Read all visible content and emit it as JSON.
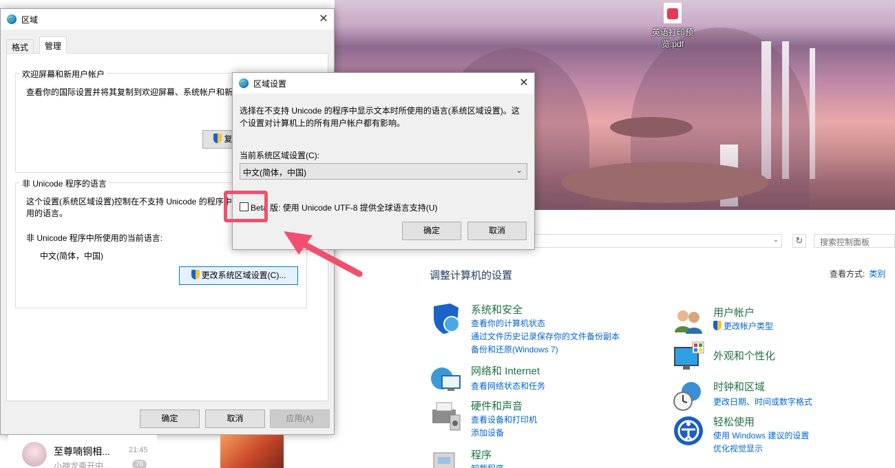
{
  "desktop": {
    "icon_label": "英语打印预览.pdf"
  },
  "control_panel": {
    "search_placeholder": "搜索控制面板",
    "title": "调整计算机的设置",
    "view_by_label": "查看方式:",
    "view_by_value": "类别",
    "categories": [
      {
        "name": "系统和安全",
        "links": [
          "查看你的计算机状态",
          "通过文件历史记录保存你的文件备份副本",
          "备份和还原(Windows 7)"
        ]
      },
      {
        "name": "网络和 Internet",
        "links": [
          "查看网络状态和任务"
        ]
      },
      {
        "name": "硬件和声音",
        "links": [
          "查看设备和打印机",
          "添加设备"
        ]
      },
      {
        "name": "程序",
        "links": [
          "卸载程序"
        ]
      },
      {
        "name": "用户帐户",
        "links": [
          "更改帐户类型"
        ]
      },
      {
        "name": "外观和个性化",
        "links": []
      },
      {
        "name": "时钟和区域",
        "links": [
          "更改日期、时间或数字格式"
        ]
      },
      {
        "name": "轻松使用",
        "links": [
          "使用 Windows 建议的设置",
          "优化视觉显示"
        ]
      }
    ]
  },
  "region_window": {
    "title": "区域",
    "tabs": [
      "格式",
      "管理"
    ],
    "welcome_group": {
      "legend": "欢迎屏幕和新用户帐户",
      "description": "查看你的国际设置并将其复制到欢迎屏幕、系统帐户和新",
      "copy_button": "复"
    },
    "non_unicode_group": {
      "legend": "非 Unicode 程序的语言",
      "description_line1": "这个设置(系统区域设置)控制在不支持 Unicode 的程序中",
      "description_line2": "用的语言。",
      "current_label": "非 Unicode 程序中所使用的当前语言:",
      "current_value": "中文(简体，中国)",
      "change_button": "更改系统区域设置(C)..."
    },
    "buttons": {
      "ok": "确定",
      "cancel": "取消",
      "apply": "应用(A)"
    }
  },
  "region_settings_dialog": {
    "title": "区域设置",
    "description_line1": "选择在不支持 Unicode 的程序中显示文本时所使用的语言(系统区域设置)。这",
    "description_line2": "个设置对计算机上的所有用户帐户都有影响。",
    "current_label": "当前系统区域设置(C):",
    "current_value": "中文(简体，中国)",
    "beta_checkbox_label": "Beta 版: 使用 Unicode UTF-8 提供全球语言支持(U)",
    "beta_checked": false,
    "buttons": {
      "ok": "确定",
      "cancel": "取消"
    }
  },
  "chat": {
    "name": "至尊喃铜相...",
    "time": "21:45",
    "preview": "小神龙斋开中...",
    "badge": "78"
  },
  "colors": {
    "highlight": "#f0506e",
    "link": "#0066cc",
    "category_heading": "#1e7145",
    "focus_border": "#0078d7"
  }
}
